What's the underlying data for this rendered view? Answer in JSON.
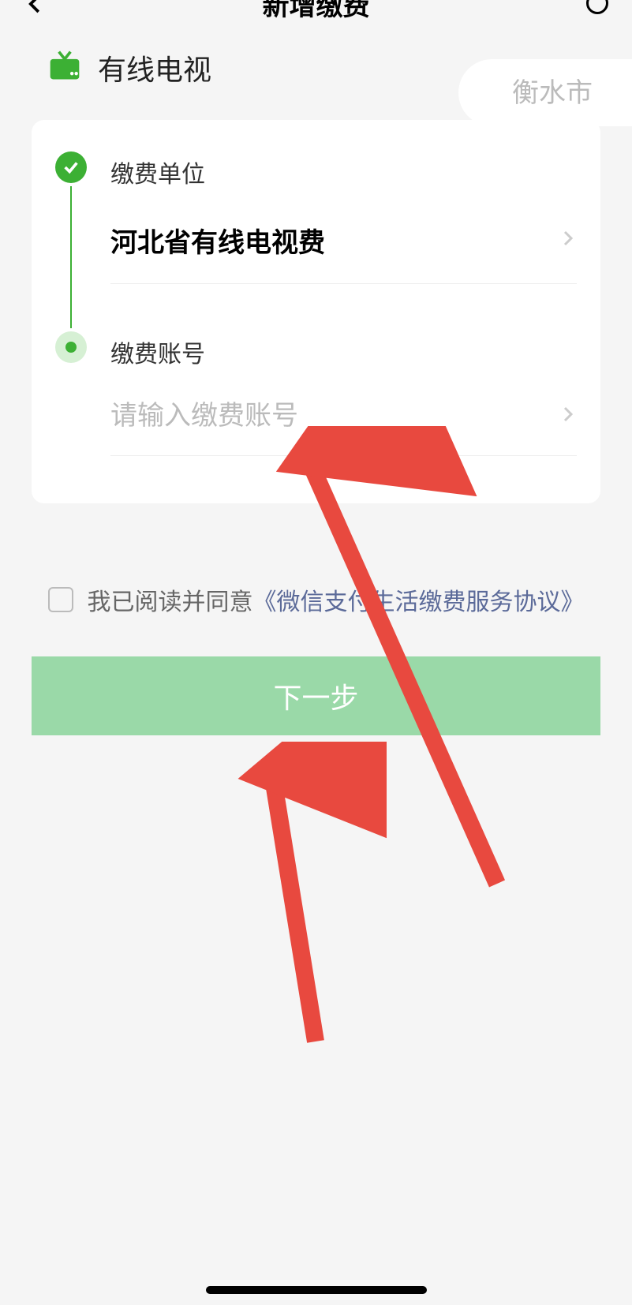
{
  "header": {
    "title": "新增缴费"
  },
  "category": {
    "label": "有线电视",
    "city": "衡水市"
  },
  "form": {
    "unit_label": "缴费单位",
    "unit_value": "河北省有线电视费",
    "account_label": "缴费账号",
    "account_placeholder": "请输入缴费账号"
  },
  "agreement": {
    "prefix": "我已阅读并同意",
    "link": "《微信支付生活缴费服务协议》"
  },
  "button": {
    "next": "下一步"
  }
}
